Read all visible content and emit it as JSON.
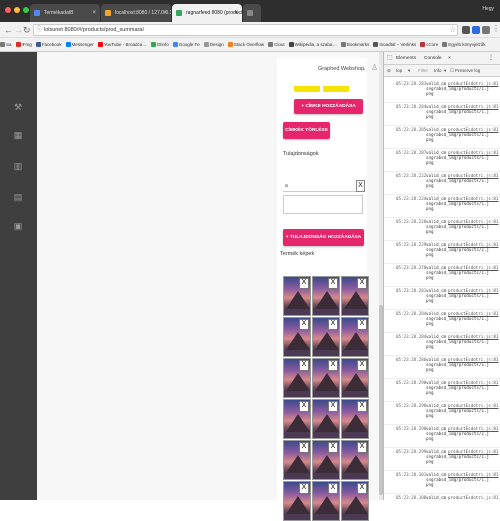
{
  "browser": {
    "tabs": [
      {
        "title": "TermékadatB",
        "active": false,
        "favicon_color": "#4c8bf5"
      },
      {
        "title": "localhost:8080 / 127.0.0.1 | …",
        "active": false,
        "favicon_color": "#f5a623"
      },
      {
        "title": "ragnarfeed 8080 (product/uni…",
        "active": true,
        "favicon_color": "#3ba55d"
      },
      {
        "title": "",
        "active": false,
        "favicon_color": "#888888"
      }
    ],
    "profile_name": "Hegy",
    "address": "lolsunet 8080/#/products/prod_summaral",
    "bookmarks": [
      {
        "label": "Sa",
        "color": "#777777"
      },
      {
        "label": "IFmg",
        "color": "#d93025"
      },
      {
        "label": "Facebook",
        "color": "#3b5998"
      },
      {
        "label": "Messenger",
        "color": "#0084ff"
      },
      {
        "label": "YouTube - Broadca…",
        "color": "#ff0000"
      },
      {
        "label": "Gtinfo",
        "color": "#34a853"
      },
      {
        "label": "Google Fe",
        "color": "#4285f4"
      },
      {
        "label": "Design",
        "color": "#999999"
      },
      {
        "label": "Stack Overflow",
        "color": "#f48024"
      },
      {
        "label": "Clout",
        "color": "#777777"
      },
      {
        "label": "Wikipédia, a szaba…",
        "color": "#444444"
      },
      {
        "label": "Bookmarks",
        "color": "#777777"
      },
      {
        "label": "Inoadtal – Verlinks",
        "color": "#555555"
      },
      {
        "label": "cCore",
        "color": "#bb3333"
      },
      {
        "label": "Egyéb könyvjelzők",
        "color": "#777777"
      }
    ]
  },
  "app": {
    "brand": "Graphed Webshop",
    "sidebar_icons": [
      "tools-icon",
      "grid-icon",
      "bar-chart-icon",
      "book-icon",
      "clipboard-icon"
    ],
    "buttons": {
      "add_tag": "+ CÍMKE HOZZÁADÁSA",
      "delete_tags": "CÍMKÉK TÖRLÉSE",
      "add_property": "+ TULAJDONSÁG HOZZÁADÁSA"
    },
    "properties_title": "Tulajdonságok",
    "property_key_value": "a",
    "remove_symbol": "X",
    "images_title": "Termék képek",
    "image_count": 18
  },
  "devtools": {
    "tabs": [
      "Elements",
      "Console"
    ],
    "active_tab": "Console",
    "filter_context": "top",
    "filter_label": "Filter",
    "level": "Info",
    "preserve": "Preserve log",
    "log_message": "valid_cm",
    "log_source": "productEsdotri.js:81",
    "log_lines": [
      "sngrabsd_img/products/1.j",
      "png"
    ],
    "log_times": [
      "05:23:28.283",
      "05:23:28.284",
      "05:23:28.285",
      "05:23:28.287",
      "05:23:28.222",
      "05:23:28.224",
      "05:23:28.228",
      "05:23:28.229",
      "05:23:28.278",
      "05:23:28.281",
      "05:23:28.284",
      "05:23:28.284",
      "05:23:28.286",
      "05:23:28.290",
      "05:23:28.298",
      "05:23:28.298",
      "05:23:28.299",
      "05:23:28.301",
      "05:23:28.308",
      "05:23:28.326"
    ]
  }
}
